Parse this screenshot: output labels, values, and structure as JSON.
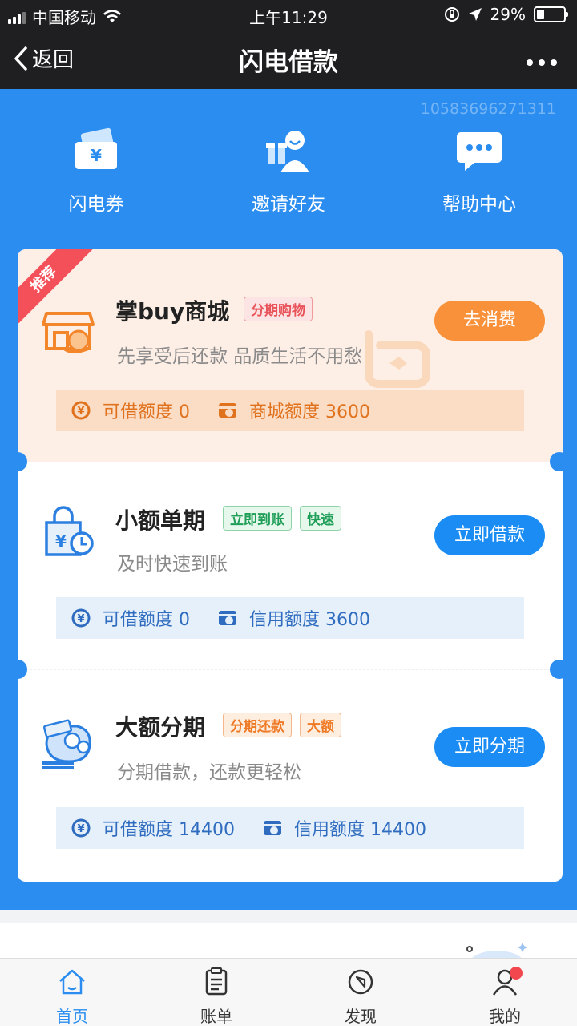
{
  "status_bar": {
    "carrier": "中国移动",
    "time": "上午11:29",
    "battery": "29%",
    "battery_level": 0.29,
    "icons": [
      "signal-icon",
      "wifi-icon",
      "rotation-lock-icon",
      "location-icon",
      "battery-icon"
    ]
  },
  "nav": {
    "back_label": "返回",
    "title": "闪电借款",
    "more_icon": "more-dots-icon"
  },
  "hero": {
    "user_id": "10583696271311",
    "quick_actions": [
      {
        "label": "闪电券",
        "icon": "coupon-icon"
      },
      {
        "label": "邀请好友",
        "icon": "invite-friend-icon"
      },
      {
        "label": "帮助中心",
        "icon": "help-chat-icon"
      }
    ]
  },
  "products": [
    {
      "ribbon": "推荐",
      "title": "掌buy商城",
      "tags": [
        "分期购物"
      ],
      "desc": "先享受后还款 品质生活不用愁",
      "button": "去消费",
      "quota_label": "可借额度 0",
      "limit_label": "商城额度 3600",
      "icon": "shop-icon",
      "color": "#f9913a"
    },
    {
      "title": "小额单期",
      "tags": [
        "立即到账",
        "快速"
      ],
      "desc": "及时快速到账",
      "button": "立即借款",
      "quota_label": "可借额度 0",
      "limit_label": "信用额度 3600",
      "icon": "bag-clock-icon",
      "color": "#1a8cf4"
    },
    {
      "title": "大额分期",
      "tags": [
        "分期还款",
        "大额"
      ],
      "desc": "分期借款，还款更轻松",
      "button": "立即分期",
      "quota_label": "可借额度 14400",
      "limit_label": "信用额度 14400",
      "icon": "money-bag-icon",
      "color": "#1a8cf4"
    }
  ],
  "tabs": [
    {
      "label": "首页",
      "icon": "home-icon",
      "active": true
    },
    {
      "label": "账单",
      "icon": "bill-icon",
      "active": false
    },
    {
      "label": "发现",
      "icon": "compass-icon",
      "active": false
    },
    {
      "label": "我的",
      "icon": "user-icon",
      "active": false,
      "badge": true
    }
  ],
  "colors": {
    "primary": "#2b8df0",
    "orange": "#f9913a",
    "ribbon_red": "#f4505a",
    "nav_bg": "#1f1f21"
  }
}
